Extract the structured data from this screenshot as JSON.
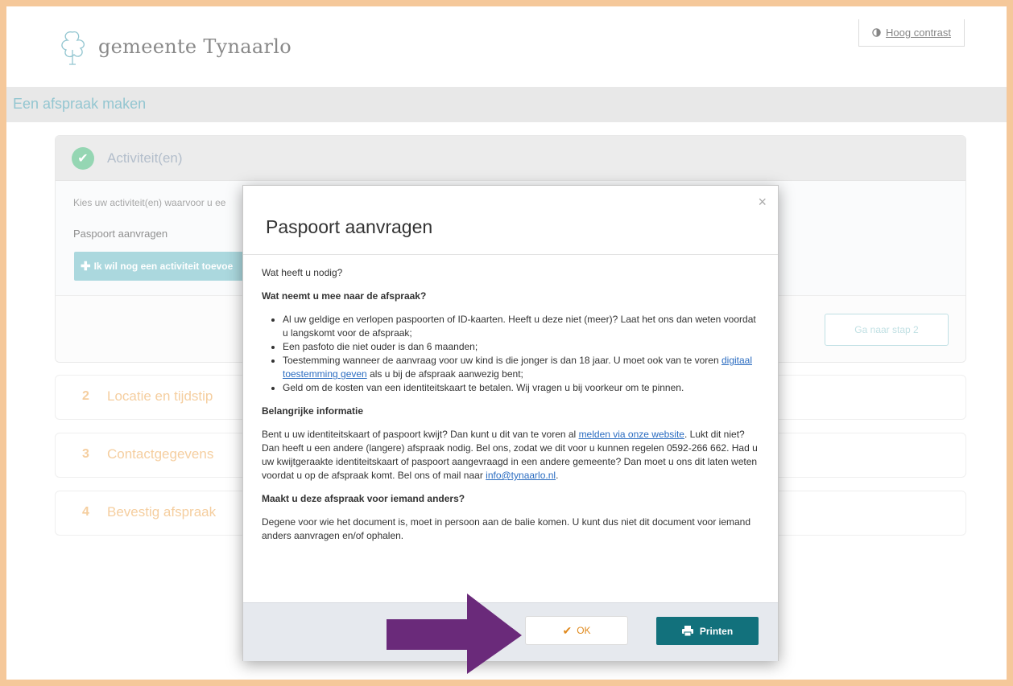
{
  "header": {
    "logo_text": "gemeente Tynaarlo",
    "contrast_label": "Hoog contrast"
  },
  "band": {
    "title": "Een afspraak maken"
  },
  "step1": {
    "title": "Activiteit(en)",
    "intro": "Kies uw activiteit(en) waarvoor u ee",
    "selected_activity": "Paspoort aanvragen",
    "add_button": "Ik wil nog een activiteit toevoe",
    "next_button": "Ga naar stap 2"
  },
  "steps": [
    {
      "num": "2",
      "label": "Locatie en tijdstip"
    },
    {
      "num": "3",
      "label": "Contactgegevens"
    },
    {
      "num": "4",
      "label": "Bevestig afspraak"
    }
  ],
  "modal": {
    "title": "Paspoort aanvragen",
    "close": "×",
    "question": "Wat heeft u nodig?",
    "section1_heading": "Wat neemt u mee naar de afspraak?",
    "bullets": {
      "b1": " Al uw geldige en verlopen paspoorten of ID-kaarten. Heeft u deze niet (meer)? Laat het ons dan weten voordat u langskomt voor de afspraak;",
      "b2": "Een pasfoto die niet ouder is dan 6 maanden;",
      "b3_pre": " Toestemming wanneer de aanvraag voor uw kind is die jonger is dan 18 jaar. U moet ook van te voren ",
      "b3_link": "digitaal toestemming geven",
      "b3_post": " als u bij de afspraak aanwezig bent;",
      "b4": "Geld om de kosten van een identiteitskaart te betalen. Wij vragen u bij voorkeur om te pinnen."
    },
    "section2_heading": "Belangrijke informatie",
    "info_pre": "Bent u uw identiteitskaart of paspoort kwijt? Dan kunt u dit van te voren al ",
    "info_link": "melden via onze website",
    "info_mid": ". Lukt dit niet? Dan heeft u een andere (langere) afspraak nodig. Bel ons, zodat we dit voor u kunnen regelen 0592-266 662. Had u uw kwijtgeraakte identiteitskaart of paspoort aangevraagd in een andere gemeente? Dan moet u ons dit laten weten voordat u op de afspraak komt. Bel ons of mail naar ",
    "info_email": "info@tynaarlo.nl",
    "info_end": ".",
    "section3_heading": "Maakt u deze afspraak voor iemand anders?",
    "other_text": "Degene voor wie het document is, moet in persoon aan de balie komen. U kunt dus niet dit document voor iemand anders aanvragen en/of ophalen.",
    "ok_label": "OK",
    "print_label": "Printen"
  },
  "colors": {
    "frame": "#f5c89a",
    "teal": "#12717c",
    "accent_orange": "#e08a1e",
    "arrow": "#6a2a7a"
  }
}
